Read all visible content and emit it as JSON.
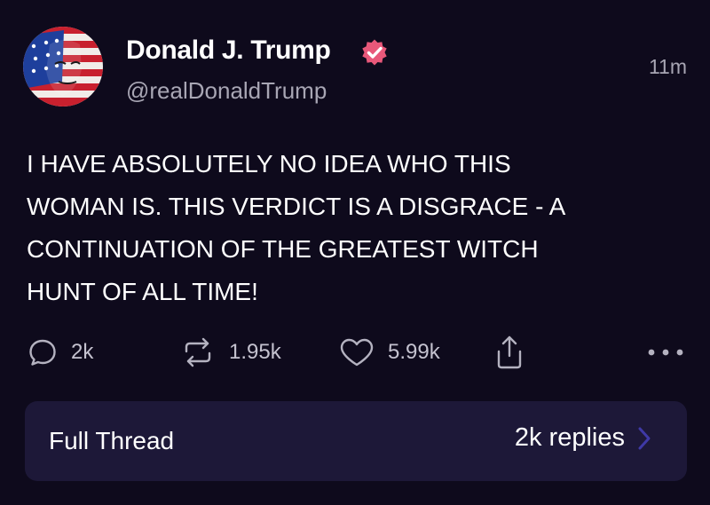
{
  "author": {
    "display_name": "Donald J. Trump",
    "handle": "@realDonaldTrump",
    "verified": true
  },
  "timestamp": "11m",
  "post": {
    "text": "I HAVE ABSOLUTELY NO IDEA WHO THIS\nWOMAN IS. THIS VERDICT IS A DISGRACE - A\nCONTINUATION OF THE GREATEST WITCH\nHUNT OF ALL TIME!"
  },
  "actions": {
    "replies": "2k",
    "reposts": "1.95k",
    "likes": "5.99k"
  },
  "thread": {
    "label": "Full Thread",
    "reply_count": "2k replies"
  },
  "colors": {
    "background": "#0e0a1c",
    "thread_bar": "#1d1838",
    "verified_badge": "#e8587a",
    "chevron": "#3f39a6",
    "secondary_text": "#a8a6b4"
  },
  "icons": [
    "avatar-flag-portrait",
    "verified-badge-icon",
    "comment-icon",
    "repost-icon",
    "heart-icon",
    "share-icon",
    "more-icon",
    "chevron-right-icon"
  ]
}
